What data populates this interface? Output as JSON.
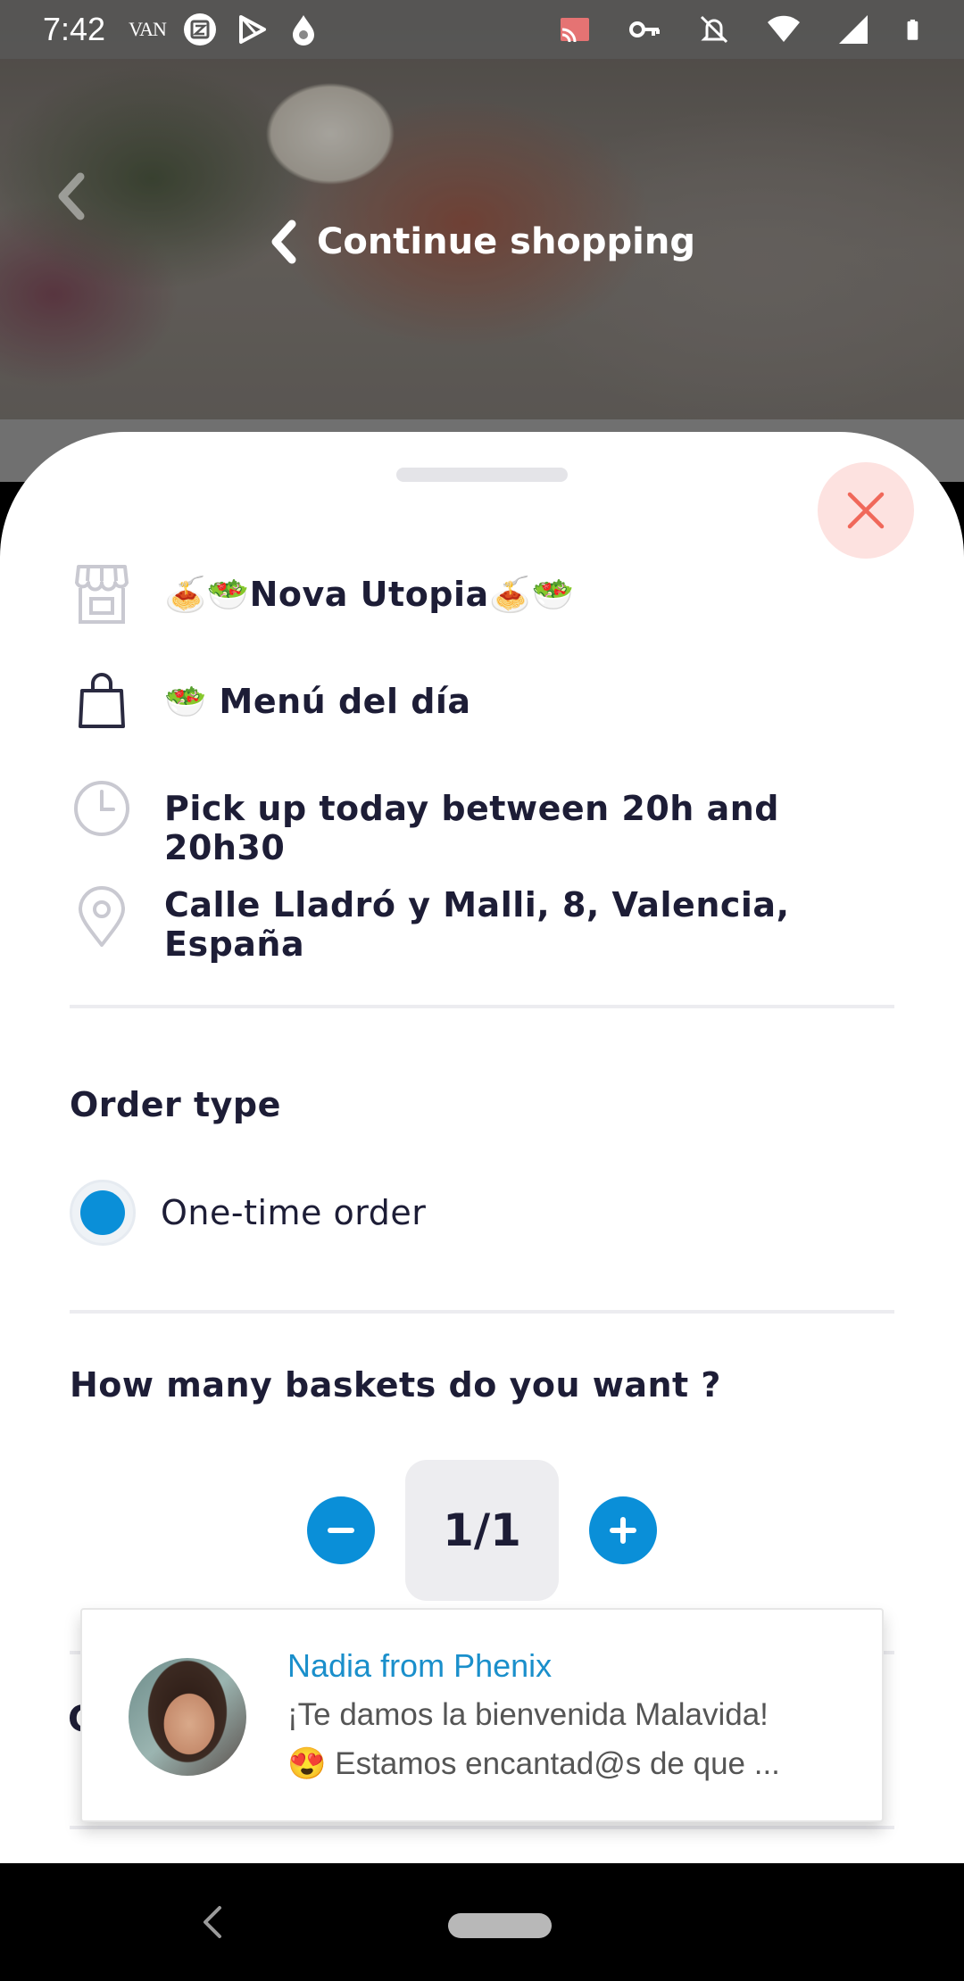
{
  "status_bar": {
    "time": "7:42",
    "carrier": "VAN",
    "left_icons": [
      "z-icon",
      "play-store-icon",
      "drop-icon"
    ],
    "right_icons": [
      "cast-icon",
      "vpn-key-icon",
      "bell-off-icon",
      "wifi-icon",
      "signal-icon",
      "battery-icon"
    ]
  },
  "hero": {
    "continue_label": "Continue shopping"
  },
  "details": {
    "store_name": "🍝🥗Nova Utopia🍝🥗",
    "basket_name": "🥗 Menú del día",
    "pickup": "Pick up today between 20h and 20h30",
    "address_line1": "Calle Lladró y Malli, 8, Valencia,",
    "address_line2": "España"
  },
  "order_type": {
    "title": "Order type",
    "option_label": "One-time order",
    "selected": true
  },
  "baskets": {
    "title": "How many baskets do you want ?",
    "quantity": "1/1"
  },
  "next_section_peek": "C",
  "chat": {
    "sender": "Nadia from Phenix",
    "line1": "¡Te damos la bienvenida Malavida!",
    "line2": "😍 Estamos encantad@s de que ..."
  },
  "colors": {
    "accent": "#0a8fd8",
    "text": "#1d1d36",
    "close_bg": "#fde2e0",
    "close_x": "#f0685a"
  }
}
